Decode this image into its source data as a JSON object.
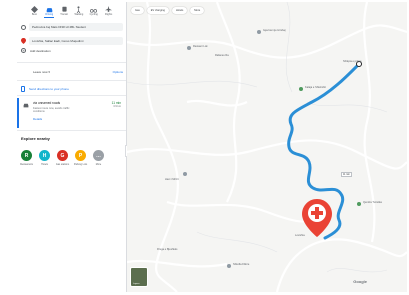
{
  "modes": [
    {
      "label": "Best"
    },
    {
      "label": "Driving"
    },
    {
      "label": "Transit"
    },
    {
      "label": "Walking"
    },
    {
      "label": "Cycling"
    },
    {
      "label": "Flights"
    }
  ],
  "route": {
    "origin": "Pedrovica bej Mats DNR HI 2BL Stedent",
    "destination": "Lovishta, Sallac Eadi, Ceres Muqedimi"
  },
  "add_destination": "Add destination",
  "leave_now": "Leave now ▾",
  "options": "Options",
  "send_to_phone": "Send directions to your phone",
  "route_card": {
    "via": "via unnamed roads",
    "time": "11 min",
    "distance": "3.9 km",
    "description": "Fastest route now, avoids traffic conditions",
    "details": "Details"
  },
  "explore": {
    "title": "Explore nearby",
    "items": [
      {
        "label": "Restaurants",
        "color": "#188038",
        "glyph": "R"
      },
      {
        "label": "Hotels",
        "color": "#12b5cb",
        "glyph": "H"
      },
      {
        "label": "Gas stations",
        "color": "#d93025",
        "glyph": "G"
      },
      {
        "label": "Parking Lots",
        "color": "#f9ab00",
        "glyph": "P"
      },
      {
        "label": "More",
        "color": "#9aa0a6",
        "glyph": "…"
      }
    ]
  },
  "map": {
    "chips": [
      "Gas",
      "EV charging",
      "Hotels",
      "More"
    ],
    "layers_label": "Layers",
    "eta_label": "11 min",
    "labels": [
      {
        "name": "Gjevrasi nje Hrisbaj"
      },
      {
        "name": "Restauri Lok"
      },
      {
        "name": "Rafanes Ra"
      },
      {
        "name": "Shtëpia e pritjes"
      },
      {
        "name": "Kalaja e Shkëmbit"
      },
      {
        "name": "Hani i Mrizit"
      },
      {
        "name": "Lovishta"
      },
      {
        "name": "Qendra Turistike"
      },
      {
        "name": "Shkolla Fillore"
      },
      {
        "name": "Rruga e Bjeshkës"
      },
      {
        "name": "Google"
      }
    ],
    "route_color": "#2b8fd6",
    "pin_color": "#ea4335"
  }
}
